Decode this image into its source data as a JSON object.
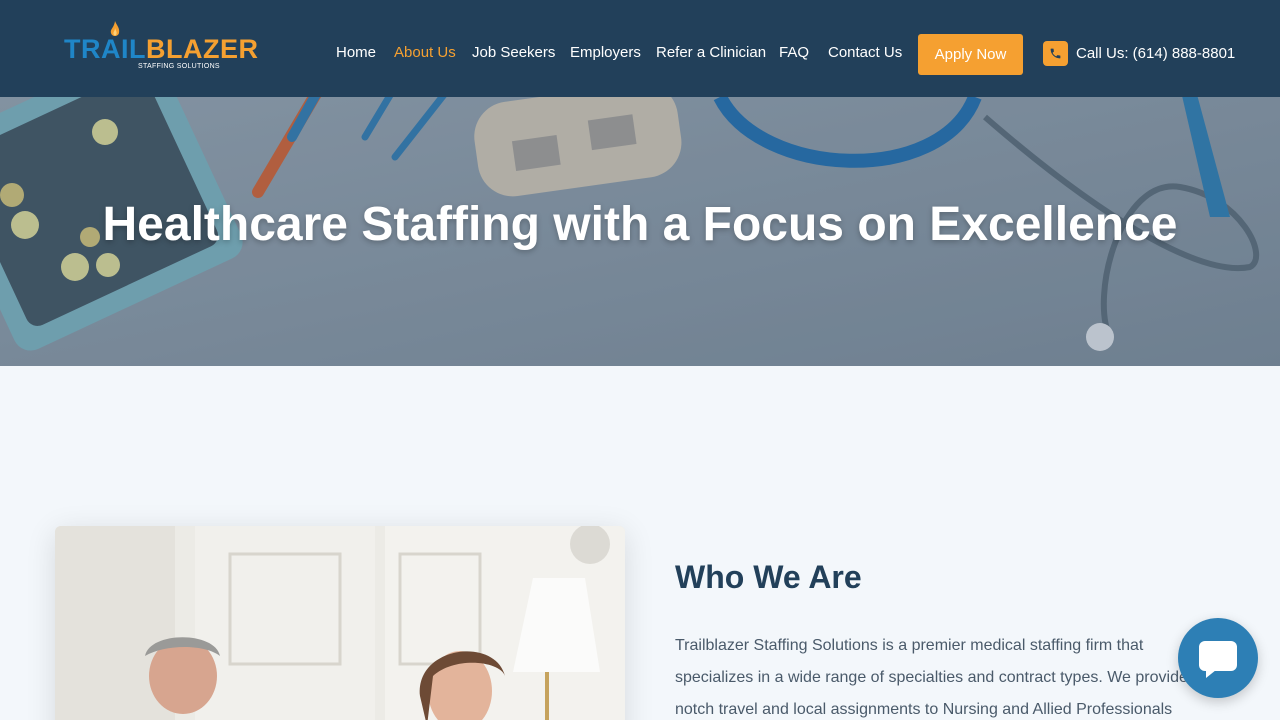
{
  "brand": {
    "name_part1": "TRAIL",
    "name_part2": "BLAZER",
    "tagline": "STAFFING SOLUTIONS"
  },
  "nav": {
    "items": [
      {
        "label": "Home",
        "active": false
      },
      {
        "label": "About Us",
        "active": true
      },
      {
        "label": "Job Seekers",
        "active": false
      },
      {
        "label": "Employers",
        "active": false
      },
      {
        "label": "Refer a Clinician",
        "active": false
      },
      {
        "label": "FAQ",
        "active": false
      },
      {
        "label": "Contact Us",
        "active": false
      }
    ],
    "apply_label": "Apply Now",
    "phone_label": "Call Us: (614) 888-8801"
  },
  "hero": {
    "title": "Healthcare Staffing with a Focus on Excellence"
  },
  "about": {
    "title": "Who We Are",
    "lines": [
      "Trailblazer Staffing Solutions is a premier medical staffing firm that",
      "specializes in a wide range of specialties and contract types. We provide",
      "notch travel and local assignments to Nursing and Allied Professionals"
    ]
  },
  "colors": {
    "header_bg": "#22405a",
    "accent": "#f5a031",
    "brand_blue": "#1f86c8",
    "page_bg": "#f3f7fb",
    "chat_bg": "#2d7fb5"
  },
  "icons": {
    "phone": "phone-icon",
    "chat": "chat-icon",
    "flame": "flame-icon"
  }
}
